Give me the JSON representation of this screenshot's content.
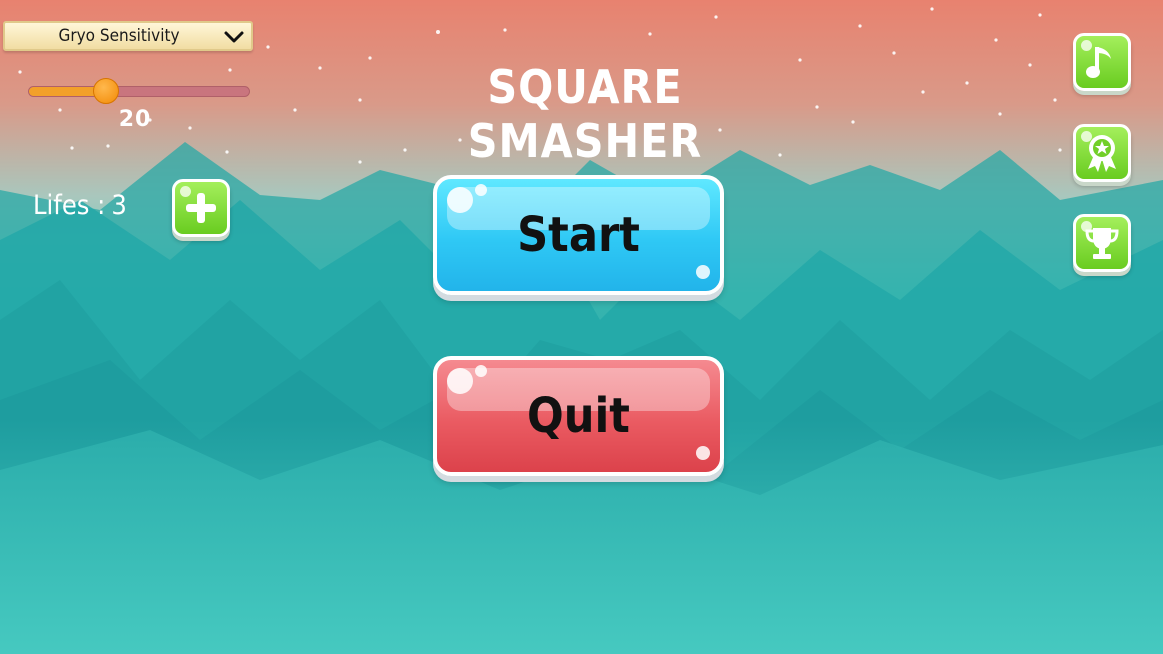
{
  "title": "SQUARE SMASHER",
  "sensitivity": {
    "dropdown_label": "Gryo Sensitivity",
    "value": "20",
    "level_fraction": 0.35
  },
  "lifes": {
    "label": "Lifes :",
    "count": "3"
  },
  "buttons": {
    "start": "Start",
    "quit": "Quit"
  },
  "side_icons": [
    "music-note-icon",
    "award-ribbon-icon",
    "trophy-icon"
  ],
  "add_icon": "plus-icon",
  "colors": {
    "sky_top": "#e88574",
    "sky_mid": "#a8c9c0",
    "teal": "#3ccfc4",
    "start_button": "#36cdf8",
    "quit_button": "#e8525a",
    "green_button": "#7ed63a",
    "slider_fill": "#f2a02a",
    "slider_thumb": "#f5920a"
  }
}
